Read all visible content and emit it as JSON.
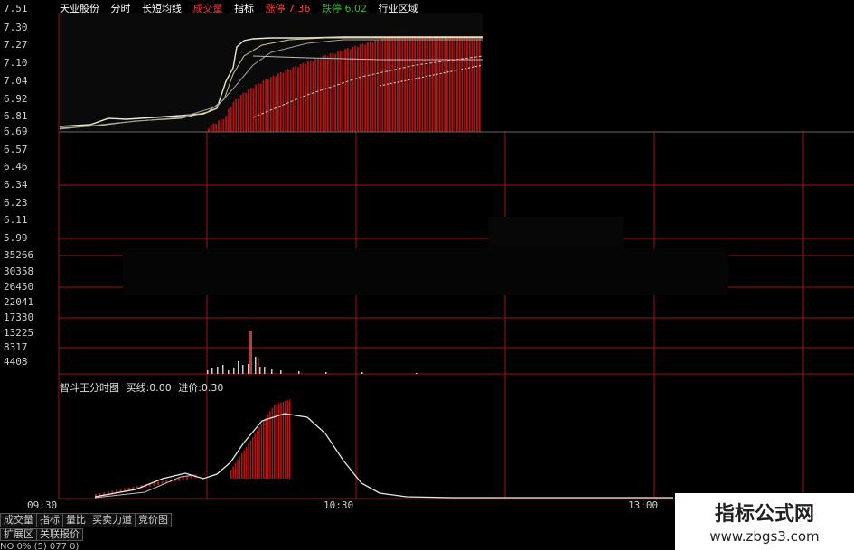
{
  "header": {
    "stock_name": "天业股份",
    "items": [
      {
        "label": "分时",
        "color": "#ffffff"
      },
      {
        "label": "长短均线",
        "color": "#ffffff"
      },
      {
        "label": "成交量",
        "color": "#ff3030"
      },
      {
        "label": "指标",
        "color": "#ffffff"
      },
      {
        "label": "涨停 7.36",
        "color": "#ff4040"
      },
      {
        "label": "跌停 6.02",
        "color": "#30c030"
      },
      {
        "label": "行业区域",
        "color": "#ffffff"
      }
    ]
  },
  "price_axis": [
    "7.51",
    "7.30",
    "7.27",
    "7.10",
    "7.04",
    "6.92",
    "6.81",
    "6.69",
    "6.57",
    "6.46",
    "6.34",
    "6.23",
    "6.11",
    "5.99"
  ],
  "volume_axis": [
    "35266",
    "30358",
    "26450",
    "22041",
    "17330",
    "13225",
    "8317",
    "4408"
  ],
  "indicator": {
    "name": "智斗王分时图",
    "buy_label": "买线:0.00",
    "entry_label": "进价:0.30"
  },
  "time_axis": [
    "09:30",
    "10:30",
    "13:00"
  ],
  "tabs": [
    "成交量",
    "指标",
    "量比",
    "买卖力道",
    "竞价图"
  ],
  "tabs_row2": [
    "扩展区",
    "关联报价"
  ],
  "status_text": "NO 0% (5) 077 0)",
  "watermark": {
    "name": "指标公式网",
    "url": "www.zbgs3.com"
  },
  "colors": {
    "grid": "#9a1414",
    "bar": "#b01515",
    "line": "#e8e8d0"
  }
}
